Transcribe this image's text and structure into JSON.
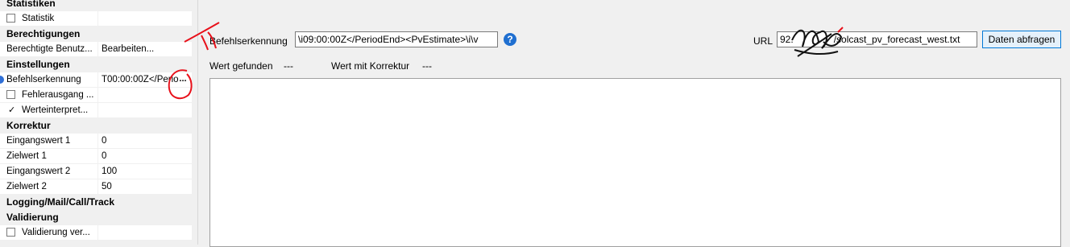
{
  "left_panel": {
    "cat_statistiken": "Statistiken",
    "statistik": {
      "label": "Statistik",
      "checked": false
    },
    "cat_berechtigungen": "Berechtigungen",
    "berechtigte": {
      "name": "Berechtigte Benutz...",
      "value": "Bearbeiten..."
    },
    "cat_einstellungen": "Einstellungen",
    "befehlserkennung": {
      "name": "Befehlserkennung",
      "value": "T00:00:00Z</Perio",
      "button": "..."
    },
    "fehlerausgang": {
      "label": "Fehlerausgang ...",
      "checked": false
    },
    "werteinterpret": {
      "label": "Werteinterpret...",
      "checked": true,
      "mark": "✓"
    },
    "cat_korrektur": "Korrektur",
    "eingangswert1": {
      "name": "Eingangswert 1",
      "value": "0"
    },
    "zielwert1": {
      "name": "Zielwert 1",
      "value": "0"
    },
    "eingangswert2": {
      "name": "Eingangswert 2",
      "value": "100"
    },
    "zielwert2": {
      "name": "Zielwert 2",
      "value": "50"
    },
    "cat_logging": "Logging/Mail/Call/Track",
    "cat_validierung": "Validierung",
    "validierung": {
      "label": "Validierung ver...",
      "checked": false
    }
  },
  "main": {
    "befehl_label": "Befehlserkennung",
    "befehl_value": "\\i09:00:00Z</PeriodEnd><PvEstimate>\\i\\v",
    "help_icon": "?",
    "url_label": "URL",
    "url_prefix": "92.",
    "url_value": "/solcast_pv_forecast_west.txt",
    "fetch_button": "Daten abfragen",
    "wert_gefunden_label": "Wert gefunden",
    "wert_gefunden_value": "---",
    "wert_korrektur_label": "Wert mit Korrektur",
    "wert_korrektur_value": "---",
    "output_text": ""
  },
  "colors": {
    "accent": "#0078d7",
    "help": "#1f6fd0",
    "annotation": "#e8101a"
  }
}
